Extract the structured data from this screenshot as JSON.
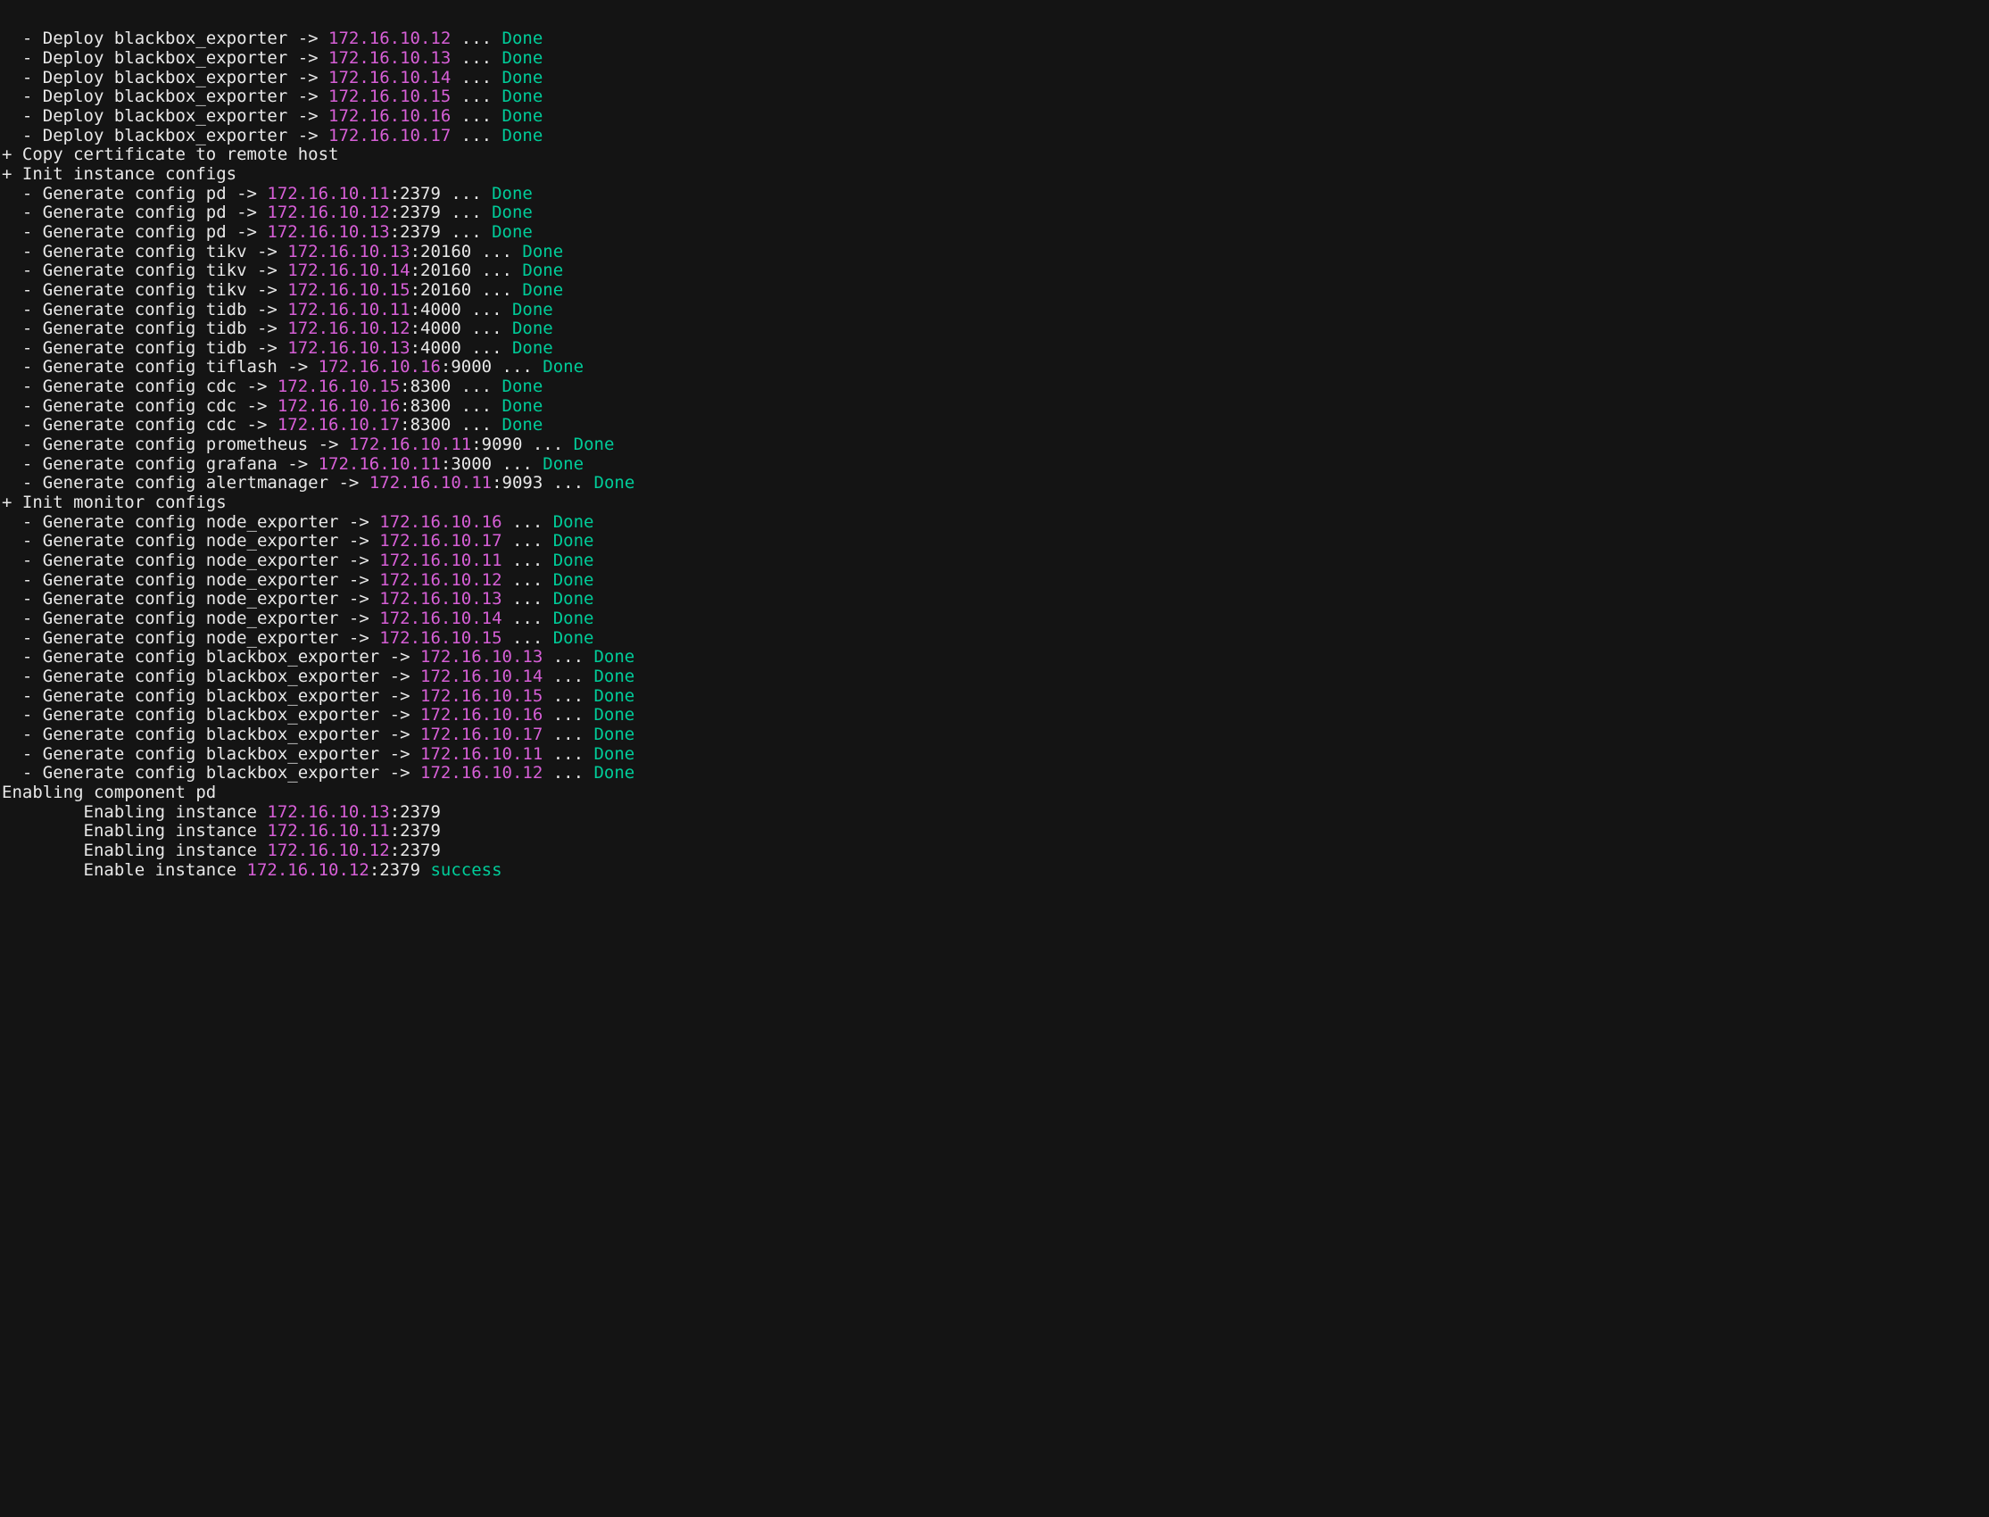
{
  "lines": [
    {
      "type": "deploy",
      "component": "blackbox_exporter",
      "ip": "172.16.10.12",
      "cut_top": true
    },
    {
      "type": "deploy",
      "component": "blackbox_exporter",
      "ip": "172.16.10.13"
    },
    {
      "type": "deploy",
      "component": "blackbox_exporter",
      "ip": "172.16.10.14"
    },
    {
      "type": "deploy",
      "component": "blackbox_exporter",
      "ip": "172.16.10.15"
    },
    {
      "type": "deploy",
      "component": "blackbox_exporter",
      "ip": "172.16.10.16"
    },
    {
      "type": "deploy",
      "component": "blackbox_exporter",
      "ip": "172.16.10.17"
    },
    {
      "type": "section",
      "text": "+ Copy certificate to remote host"
    },
    {
      "type": "section",
      "text": "+ Init instance configs"
    },
    {
      "type": "gen",
      "component": "pd",
      "ip": "172.16.10.11",
      "port": ":2379"
    },
    {
      "type": "gen",
      "component": "pd",
      "ip": "172.16.10.12",
      "port": ":2379"
    },
    {
      "type": "gen",
      "component": "pd",
      "ip": "172.16.10.13",
      "port": ":2379"
    },
    {
      "type": "gen",
      "component": "tikv",
      "ip": "172.16.10.13",
      "port": ":20160"
    },
    {
      "type": "gen",
      "component": "tikv",
      "ip": "172.16.10.14",
      "port": ":20160"
    },
    {
      "type": "gen",
      "component": "tikv",
      "ip": "172.16.10.15",
      "port": ":20160"
    },
    {
      "type": "gen",
      "component": "tidb",
      "ip": "172.16.10.11",
      "port": ":4000"
    },
    {
      "type": "gen",
      "component": "tidb",
      "ip": "172.16.10.12",
      "port": ":4000"
    },
    {
      "type": "gen",
      "component": "tidb",
      "ip": "172.16.10.13",
      "port": ":4000"
    },
    {
      "type": "gen",
      "component": "tiflash",
      "ip": "172.16.10.16",
      "port": ":9000"
    },
    {
      "type": "gen",
      "component": "cdc",
      "ip": "172.16.10.15",
      "port": ":8300"
    },
    {
      "type": "gen",
      "component": "cdc",
      "ip": "172.16.10.16",
      "port": ":8300"
    },
    {
      "type": "gen",
      "component": "cdc",
      "ip": "172.16.10.17",
      "port": ":8300"
    },
    {
      "type": "gen",
      "component": "prometheus",
      "ip": "172.16.10.11",
      "port": ":9090"
    },
    {
      "type": "gen",
      "component": "grafana",
      "ip": "172.16.10.11",
      "port": ":3000"
    },
    {
      "type": "gen",
      "component": "alertmanager",
      "ip": "172.16.10.11",
      "port": ":9093"
    },
    {
      "type": "section",
      "text": "+ Init monitor configs"
    },
    {
      "type": "gen",
      "component": "node_exporter",
      "ip": "172.16.10.16"
    },
    {
      "type": "gen",
      "component": "node_exporter",
      "ip": "172.16.10.17"
    },
    {
      "type": "gen",
      "component": "node_exporter",
      "ip": "172.16.10.11"
    },
    {
      "type": "gen",
      "component": "node_exporter",
      "ip": "172.16.10.12"
    },
    {
      "type": "gen",
      "component": "node_exporter",
      "ip": "172.16.10.13"
    },
    {
      "type": "gen",
      "component": "node_exporter",
      "ip": "172.16.10.14"
    },
    {
      "type": "gen",
      "component": "node_exporter",
      "ip": "172.16.10.15"
    },
    {
      "type": "gen",
      "component": "blackbox_exporter",
      "ip": "172.16.10.13"
    },
    {
      "type": "gen",
      "component": "blackbox_exporter",
      "ip": "172.16.10.14"
    },
    {
      "type": "gen",
      "component": "blackbox_exporter",
      "ip": "172.16.10.15"
    },
    {
      "type": "gen",
      "component": "blackbox_exporter",
      "ip": "172.16.10.16"
    },
    {
      "type": "gen",
      "component": "blackbox_exporter",
      "ip": "172.16.10.17"
    },
    {
      "type": "gen",
      "component": "blackbox_exporter",
      "ip": "172.16.10.11"
    },
    {
      "type": "gen",
      "component": "blackbox_exporter",
      "ip": "172.16.10.12"
    },
    {
      "type": "plain",
      "text": "Enabling component pd"
    },
    {
      "type": "enabling",
      "ip": "172.16.10.13",
      "port": ":2379"
    },
    {
      "type": "enabling",
      "ip": "172.16.10.11",
      "port": ":2379"
    },
    {
      "type": "enabling",
      "ip": "172.16.10.12",
      "port": ":2379"
    },
    {
      "type": "enable_success",
      "ip": "172.16.10.12",
      "port": ":2379"
    }
  ],
  "strings": {
    "deploy_prefix": "  - Deploy ",
    "gen_prefix": "  - Generate config ",
    "arrow": " -> ",
    "dots_done": " ... ",
    "done": "Done",
    "enabling_prefix": "        Enabling instance ",
    "enable_prefix": "        Enable instance ",
    "success": "success"
  }
}
